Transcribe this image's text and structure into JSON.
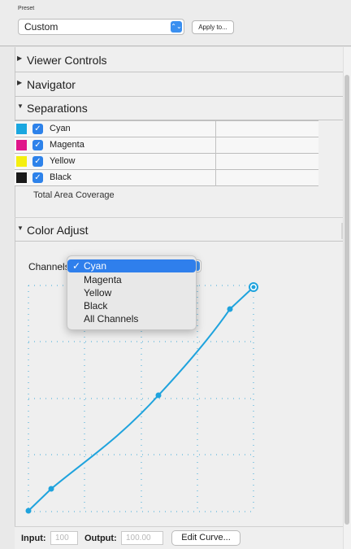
{
  "preset": {
    "label": "Preset",
    "value": "Custom",
    "apply_label": "Apply to..."
  },
  "sections": [
    {
      "title": "Viewer Controls",
      "expanded": false
    },
    {
      "title": "Navigator",
      "expanded": false
    },
    {
      "title": "Separations",
      "expanded": true
    },
    {
      "title": "Color Adjust",
      "expanded": true
    }
  ],
  "separations": {
    "rows": [
      {
        "name": "Cyan",
        "color": "#1aa7e0",
        "checked": true
      },
      {
        "name": "Magenta",
        "color": "#e0158a",
        "checked": true
      },
      {
        "name": "Yellow",
        "color": "#f5ef0f",
        "checked": true
      },
      {
        "name": "Black",
        "color": "#1a1a1a",
        "checked": true
      }
    ],
    "total_area_coverage": "Total Area Coverage"
  },
  "color_adjust": {
    "channels_label": "Channels",
    "channel_options": [
      "Cyan",
      "Magenta",
      "Yellow",
      "Black",
      "All Channels"
    ],
    "selected_channel": "Cyan",
    "curve_color": "#1fa3dd"
  },
  "bottom": {
    "input_label": "Input:",
    "input_value": "100",
    "output_label": "Output:",
    "output_value": "100.00",
    "edit_curve_label": "Edit Curve..."
  }
}
